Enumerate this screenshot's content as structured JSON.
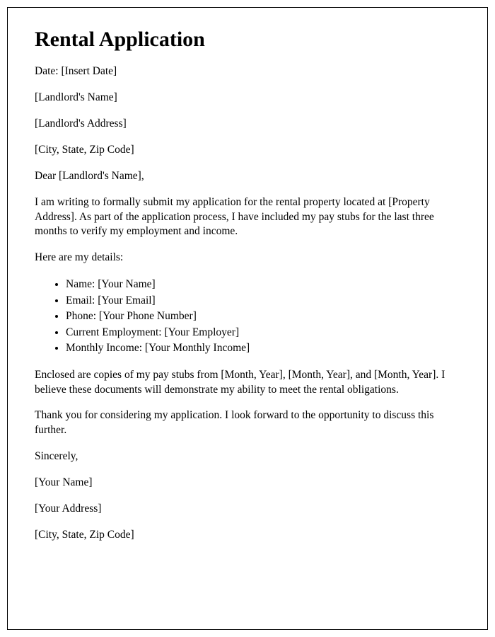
{
  "title": "Rental Application",
  "date_line": "Date: [Insert Date]",
  "landlord_name": "[Landlord's Name]",
  "landlord_address": "[Landlord's Address]",
  "landlord_city": "[City, State, Zip Code]",
  "salutation": "Dear [Landlord's Name],",
  "intro_paragraph": "I am writing to formally submit my application for the rental property located at [Property Address]. As part of the application process, I have included my pay stubs for the last three months to verify my employment and income.",
  "details_heading": "Here are my details:",
  "details": [
    "Name: [Your Name]",
    "Email: [Your Email]",
    "Phone: [Your Phone Number]",
    "Current Employment: [Your Employer]",
    "Monthly Income: [Your Monthly Income]"
  ],
  "enclosed_paragraph": "Enclosed are copies of my pay stubs from [Month, Year], [Month, Year], and [Month, Year]. I believe these documents will demonstrate my ability to meet the rental obligations.",
  "thanks_paragraph": "Thank you for considering my application. I look forward to the opportunity to discuss this further.",
  "closing": "Sincerely,",
  "sender_name": "[Your Name]",
  "sender_address": "[Your Address]",
  "sender_city": "[City, State, Zip Code]"
}
